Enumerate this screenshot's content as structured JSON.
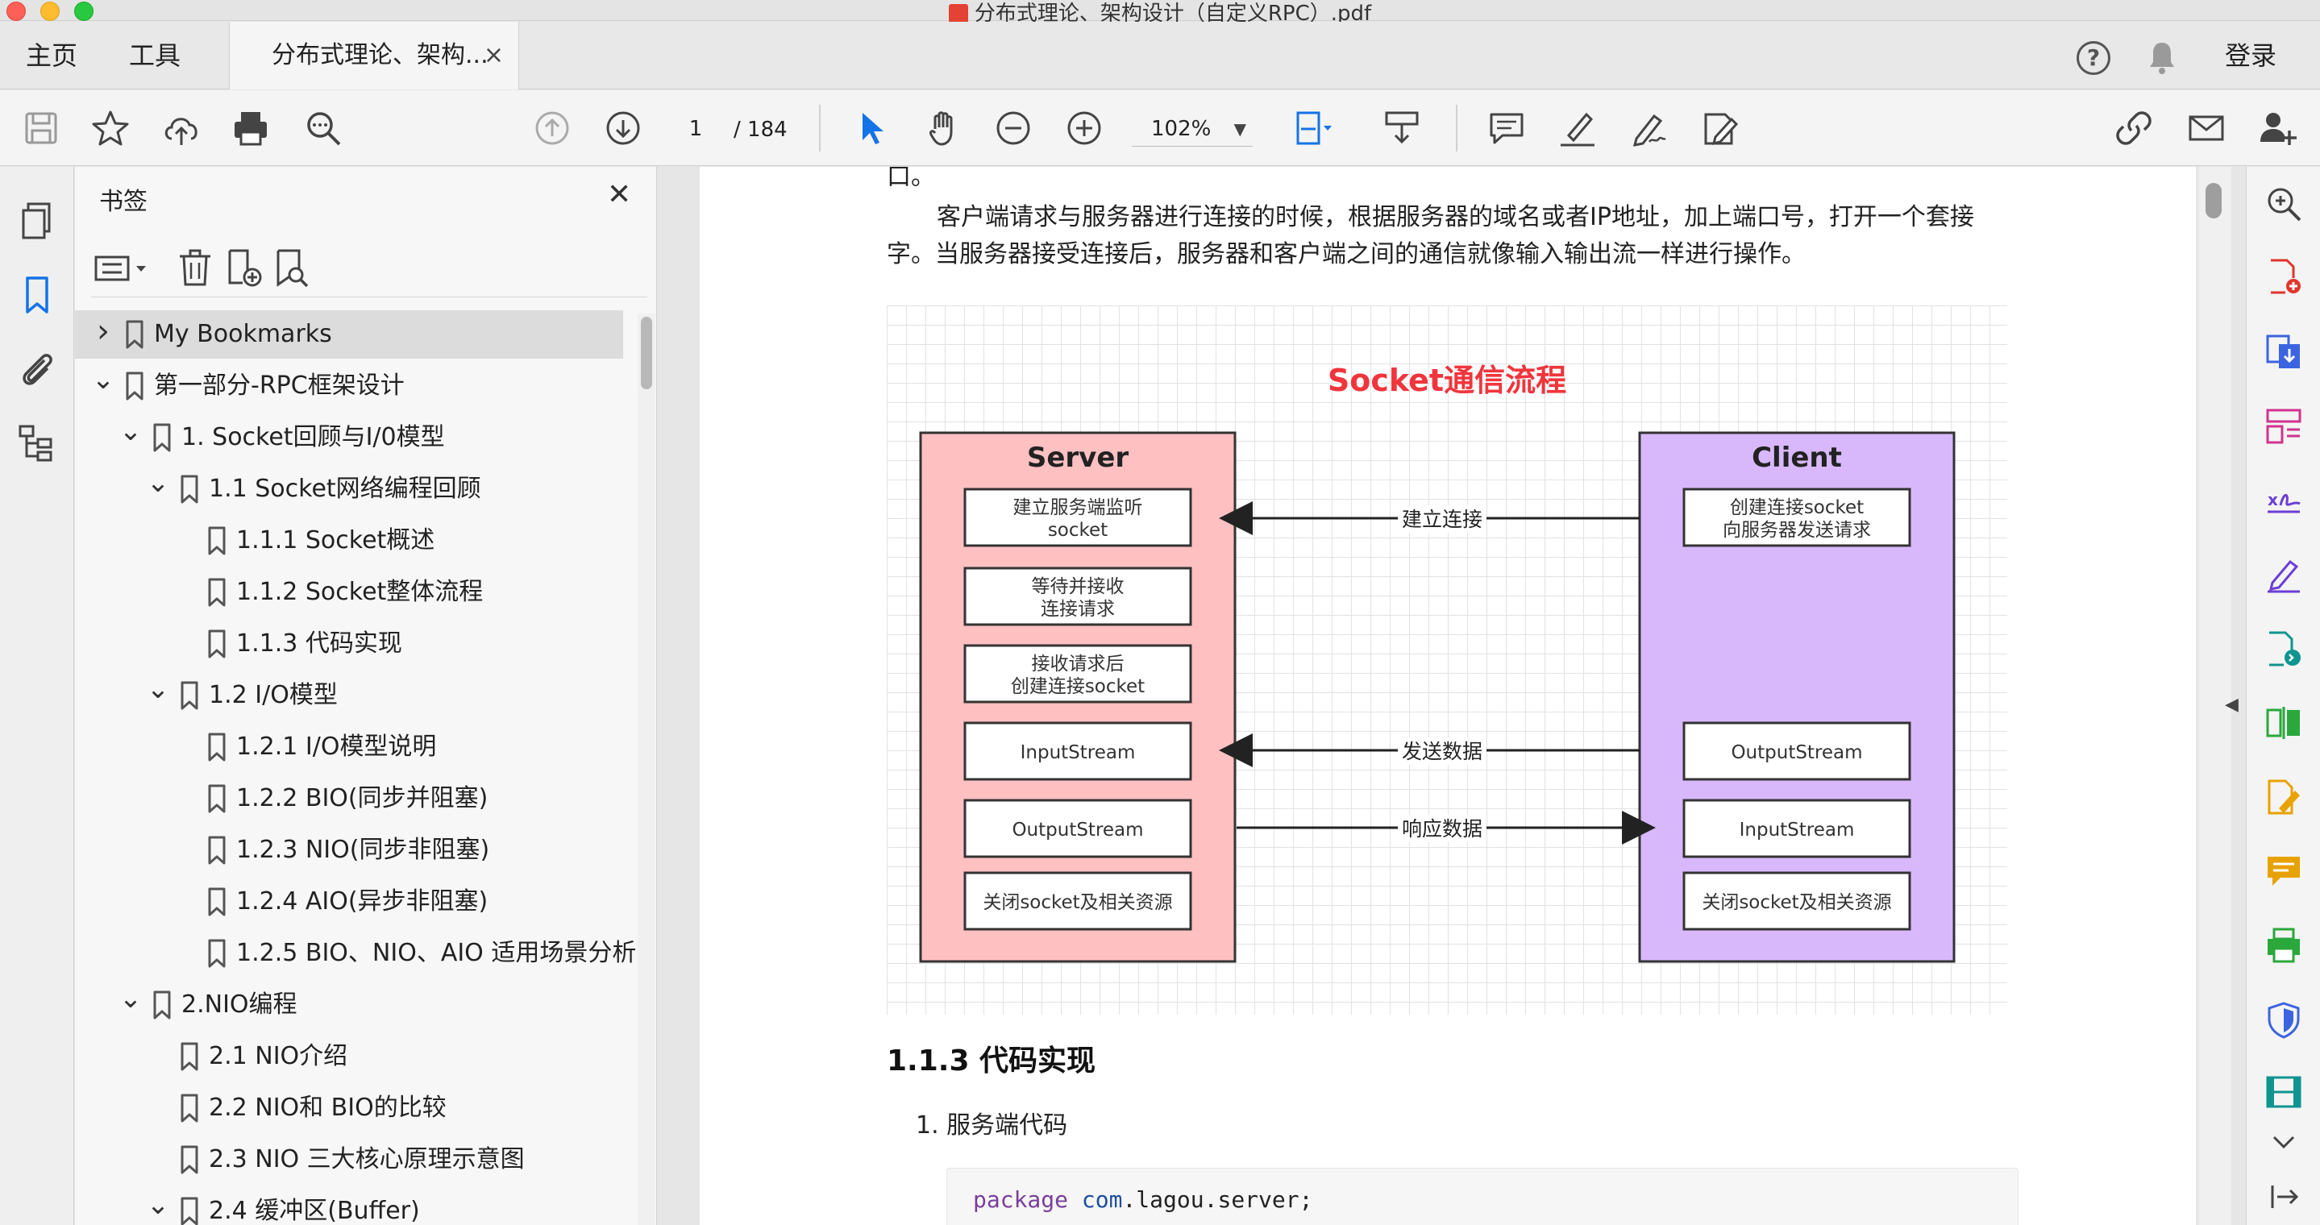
{
  "window": {
    "title": "分布式理论、架构设计（自定义RPC）.pdf"
  },
  "tabs": {
    "home": "主页",
    "tools": "工具",
    "document": "分布式理论、架构...",
    "close": "×",
    "login": "登录"
  },
  "toolbar": {
    "page_current": "1",
    "page_total": "/ 184",
    "zoom": "102%"
  },
  "bookmarks": {
    "title": "书签",
    "close": "✕",
    "items": [
      {
        "label": "My Bookmarks",
        "level": 0,
        "caret": "right",
        "selected": true
      },
      {
        "label": "第一部分-RPC框架设计",
        "level": 0,
        "caret": "down"
      },
      {
        "label": "1. Socket回顾与I/0模型",
        "level": 1,
        "caret": "down"
      },
      {
        "label": "1.1 Socket网络编程回顾",
        "level": 2,
        "caret": "down"
      },
      {
        "label": "1.1.1 Socket概述",
        "level": 3,
        "caret": ""
      },
      {
        "label": "1.1.2 Socket整体流程",
        "level": 3,
        "caret": ""
      },
      {
        "label": "1.1.3 代码实现",
        "level": 3,
        "caret": ""
      },
      {
        "label": "1.2  I/O模型",
        "level": 2,
        "caret": "down"
      },
      {
        "label": "1.2.1 I/O模型说明",
        "level": 3,
        "caret": ""
      },
      {
        "label": "1.2.2 BIO(同步并阻塞)",
        "level": 3,
        "caret": ""
      },
      {
        "label": "1.2.3 NIO(同步非阻塞)",
        "level": 3,
        "caret": ""
      },
      {
        "label": "1.2.4 AIO(异步非阻塞)",
        "level": 3,
        "caret": ""
      },
      {
        "label": "1.2.5 BIO、NIO、AIO 适用场景分析",
        "level": 3,
        "caret": ""
      },
      {
        "label": "2.NIO编程",
        "level": 1,
        "caret": "down"
      },
      {
        "label": "2.1 NIO介绍",
        "level": 2,
        "caret": ""
      },
      {
        "label": "2.2  NIO和 BIO的比较",
        "level": 2,
        "caret": ""
      },
      {
        "label": "2.3 NIO 三大核心原理示意图",
        "level": 2,
        "caret": ""
      },
      {
        "label": "2.4 缓冲区(Buffer)",
        "level": 2,
        "caret": "down"
      }
    ]
  },
  "document": {
    "top_fragment": "口。",
    "paragraph_line1": "客户端请求与服务器进行连接的时候，根据服务器的域名或者IP地址，加上端口号，打开一个套接",
    "paragraph_line2": "字。当服务器接受连接后，服务器和客户端之间的通信就像输入输出流一样进行操作。",
    "diagram": {
      "title": "Socket通信流程",
      "server": {
        "label": "Server",
        "steps": [
          {
            "line1": "建立服务端监听",
            "line2": "socket"
          },
          {
            "line1": "等待并接收",
            "line2": "连接请求"
          },
          {
            "line1": "接收请求后",
            "line2": "创建连接socket"
          },
          {
            "line1": "InputStream",
            "line2": ""
          },
          {
            "line1": "OutputStream",
            "line2": ""
          },
          {
            "line1": "关闭socket及相关资源",
            "line2": ""
          }
        ]
      },
      "client": {
        "label": "Client",
        "steps": [
          {
            "line1": "创建连接socket",
            "line2": "向服务器发送请求"
          },
          {
            "line1": "OutputStream",
            "line2": ""
          },
          {
            "line1": "InputStream",
            "line2": ""
          },
          {
            "line1": "关闭socket及相关资源",
            "line2": ""
          }
        ]
      },
      "arrows": {
        "connect": "建立连接",
        "send": "发送数据",
        "respond": "响应数据"
      },
      "colors": {
        "title": "#f0353c",
        "server_fill": "#ffc0c2",
        "client_fill": "#d8b8fb",
        "box_border": "#333333"
      }
    },
    "section_heading": "1.1.3 代码实现",
    "list_item": "1. 服务端代码",
    "code": {
      "keyword": "package",
      "package_name": "com",
      "rest": ".lagou.server;"
    }
  },
  "icons": {
    "toolbar": [
      "save-icon",
      "star-icon",
      "upload-icon",
      "print-icon",
      "search-icon",
      "page-up-icon",
      "page-down-icon",
      "select-cursor-icon",
      "hand-icon",
      "zoom-out-icon",
      "zoom-in-icon",
      "fit-page-icon",
      "scroll-mode-icon",
      "comment-icon",
      "highlight-icon",
      "sign-icon",
      "fill-sign-icon",
      "link-icon",
      "email-icon",
      "share-user-icon"
    ],
    "left_rail": [
      "pages-icon",
      "bookmark-icon",
      "attachment-icon",
      "structure-icon"
    ],
    "right_rail": [
      "zoom-search-icon",
      "create-pdf-icon",
      "export-pdf-icon",
      "organize-pages-icon",
      "fill-sign-icon",
      "sign-icon",
      "send-review-icon",
      "compare-icon",
      "edit-pdf-icon",
      "comment-icon",
      "print-production-icon",
      "protect-icon",
      "rich-media-icon",
      "expand-icon"
    ]
  }
}
